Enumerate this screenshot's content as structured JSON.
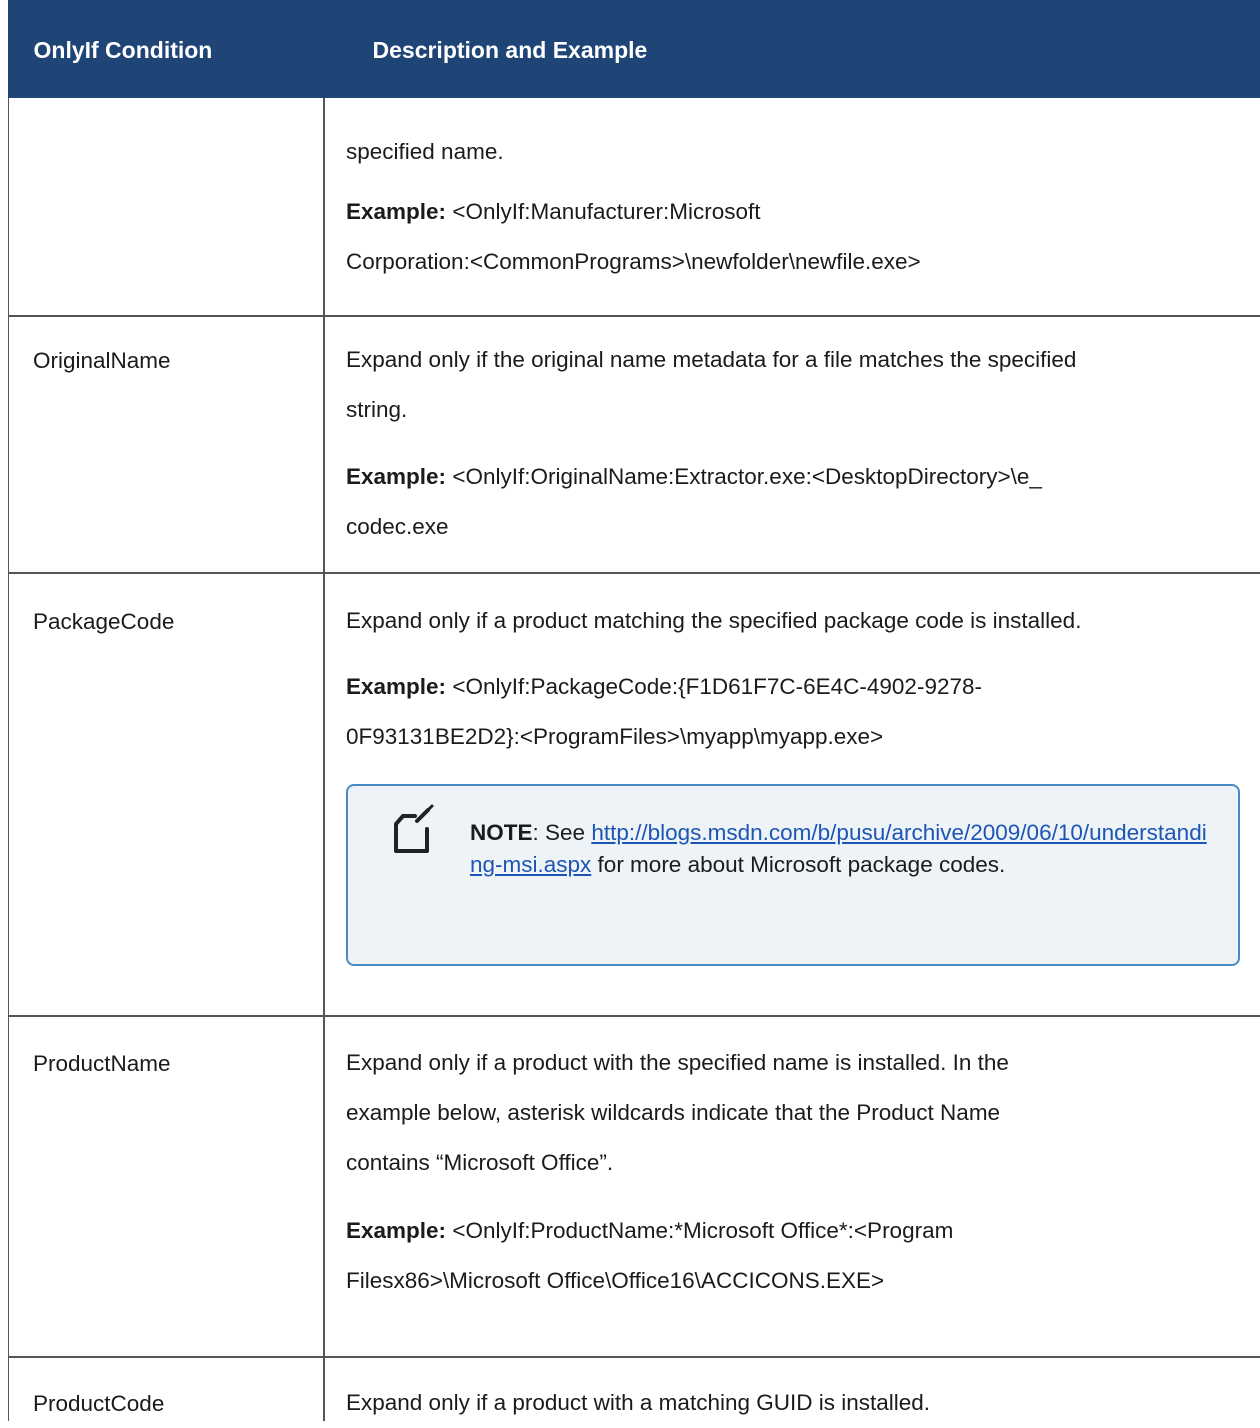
{
  "header": {
    "col1": "OnlyIf Condition",
    "col2": "Description and Example"
  },
  "example_label": "Example:",
  "rows": [
    {
      "condition": "",
      "description": "specified name.",
      "example_line1": "<OnlyIf:Manufacturer:Microsoft",
      "example_line2": "Corporation:<CommonPrograms>\\newfolder\\newfile.exe>"
    },
    {
      "condition": "OriginalName",
      "description_line1": "Expand only if the original name metadata for a file matches the specified",
      "description_line2": "string.",
      "example_line1": "<OnlyIf:OriginalName:Extractor.exe:<DesktopDirectory>\\e_",
      "example_line2": "codec.exe"
    },
    {
      "condition": "PackageCode",
      "description": "Expand only if a product matching the specified package code is installed.",
      "example_line1": "<OnlyIf:PackageCode:{F1D61F7C-6E4C-4902-9278-",
      "example_line2": "0F93131BE2D2}:<ProgramFiles>\\myapp\\myapp.exe>",
      "note": {
        "label": "NOTE",
        "text_before": ": See ",
        "link": "http://blogs.msdn.com/b/pusu/archive/2009/06/10/understanding-msi.aspx",
        "text_after": " for more about Microsoft package codes."
      }
    },
    {
      "condition": "ProductName",
      "description_line1": "Expand only if a product with the specified name is installed. In the",
      "description_line2": "example below, asterisk wildcards indicate that the Product Name",
      "description_line3": "contains “Microsoft Office”.",
      "example_line1": "<OnlyIf:ProductName:*Microsoft Office*:<Program",
      "example_line2": "Filesx86>\\Microsoft Office\\Office16\\ACCICONS.EXE>"
    },
    {
      "condition": "ProductCode",
      "description": "Expand only if a product with a matching GUID is installed."
    }
  ]
}
